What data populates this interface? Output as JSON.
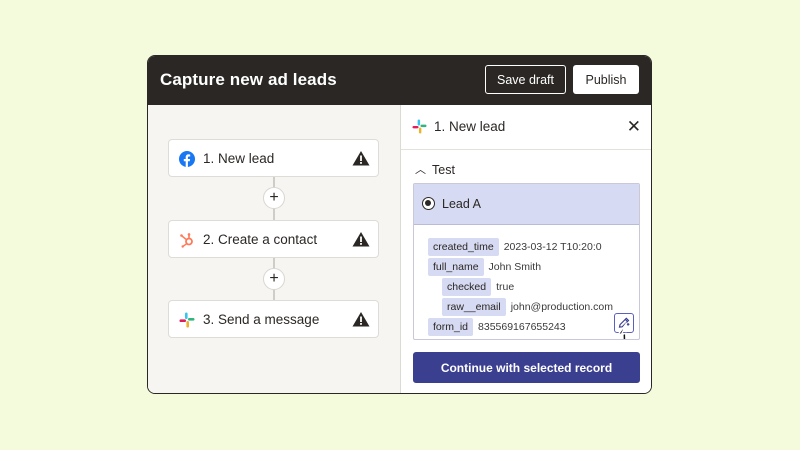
{
  "header": {
    "title": "Capture new ad leads",
    "save_draft_label": "Save draft",
    "publish_label": "Publish"
  },
  "steps": [
    {
      "label": "1. New lead",
      "icon": "facebook-icon"
    },
    {
      "label": "2. Create a contact",
      "icon": "hubspot-icon"
    },
    {
      "label": "3. Send a message",
      "icon": "slack-icon"
    }
  ],
  "panel": {
    "title": "1. New lead",
    "icon": "slack-icon",
    "test_label": "Test",
    "lead_name": "Lead A",
    "fields": [
      {
        "key": "created_time",
        "value": "2023-03-12 T10:20:0"
      },
      {
        "key": "full_name",
        "value": "John Smith"
      },
      {
        "key": "checked",
        "value": "true"
      },
      {
        "key": "raw__email",
        "value": "john@production.com"
      },
      {
        "key": "form_id",
        "value": "835569167655243"
      }
    ],
    "continue_label": "Continue with selected record"
  },
  "colors": {
    "background": "#f3fbdc",
    "header": "#2b2724",
    "accent": "#3b3f8f",
    "highlight": "#d6daf2",
    "facebook": "#1877f2",
    "hubspot": "#ff7a59"
  }
}
